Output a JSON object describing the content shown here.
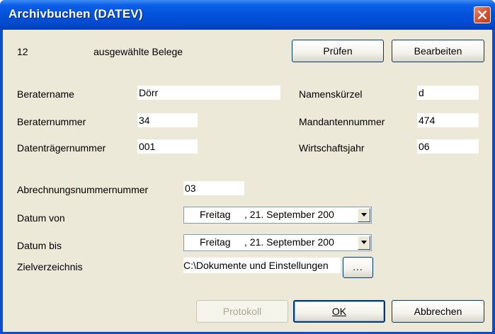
{
  "window": {
    "title": "Archivbuchen (DATEV)",
    "close_icon": "close-icon"
  },
  "summary": {
    "count": "12",
    "label": "ausgewählte Belege"
  },
  "toolbar": {
    "check_label": "Prüfen",
    "edit_label": "Bearbeiten"
  },
  "fields": {
    "beratername": {
      "label": "Beratername",
      "value": "Dörr"
    },
    "beraternummer": {
      "label": "Beraternummer",
      "value": "34"
    },
    "datentraegernummer": {
      "label": "Datenträgernummer",
      "value": "001"
    },
    "namenskuerzel": {
      "label": "Namenskürzel",
      "value": "d"
    },
    "mandantennummer": {
      "label": "Mandantennummer",
      "value": "474"
    },
    "wirtschaftsjahr": {
      "label": "Wirtschaftsjahr",
      "value": "06"
    },
    "abrechnungsnummer": {
      "label": "Abrechnungsnummernummer",
      "value": "03"
    }
  },
  "dates": {
    "from": {
      "label": "Datum von",
      "weekday": "Freitag",
      "date": ", 21. September 200"
    },
    "to": {
      "label": "Datum bis",
      "weekday": "Freitag",
      "date": ", 21. September 200"
    }
  },
  "target_dir": {
    "label": "Zielverzeichnis",
    "value": "C:\\Dokumente und Einstellungen",
    "browse_label": "..."
  },
  "footer": {
    "protocol_label": "Protokoll",
    "ok_label": "OK",
    "cancel_label": "Abbrechen"
  }
}
